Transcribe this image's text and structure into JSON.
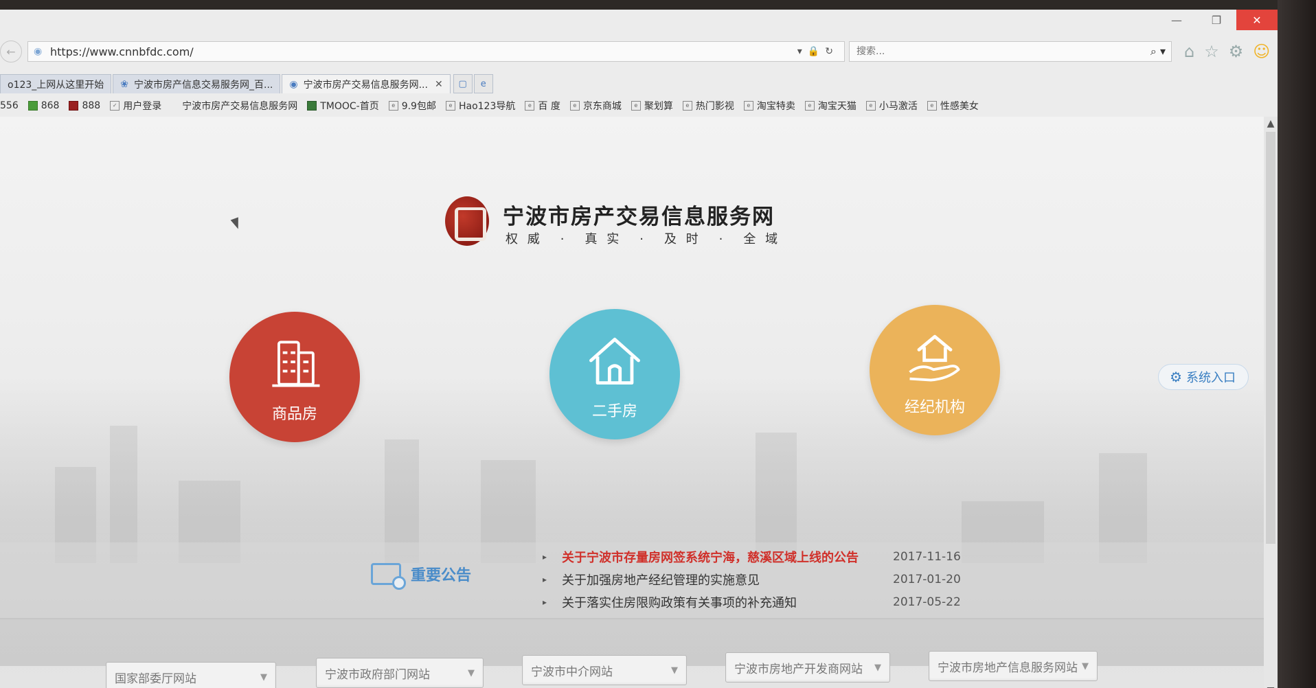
{
  "browser": {
    "url": "https://www.cnnbfdc.com/",
    "search_placeholder": "搜索...",
    "tabs": [
      {
        "label": "o123_上网从这里开始",
        "active": false
      },
      {
        "label": "宁波市房产信息交易服务网_百...",
        "active": false
      },
      {
        "label": "宁波市房产交易信息服务网...",
        "active": true
      }
    ],
    "favorites": [
      {
        "label": "556",
        "icon": "favicon"
      },
      {
        "label": "868",
        "icon": "green-leaf-icon"
      },
      {
        "label": "888",
        "icon": "red-square-icon"
      },
      {
        "label": "用户登录",
        "icon": "shield-icon"
      },
      {
        "label": "宁波市房产交易信息服务网",
        "icon": "none"
      },
      {
        "label": "TMOOC-首页",
        "icon": "tm-icon"
      },
      {
        "label": "9.9包邮",
        "icon": "page-icon"
      },
      {
        "label": "Hao123导航",
        "icon": "page-icon"
      },
      {
        "label": "百 度",
        "icon": "page-icon"
      },
      {
        "label": "京东商城",
        "icon": "page-icon"
      },
      {
        "label": "聚划算",
        "icon": "page-icon"
      },
      {
        "label": "热门影视",
        "icon": "page-icon"
      },
      {
        "label": "淘宝特卖",
        "icon": "page-icon"
      },
      {
        "label": "淘宝天猫",
        "icon": "page-icon"
      },
      {
        "label": "小马激活",
        "icon": "page-icon"
      },
      {
        "label": "性感美女",
        "icon": "page-icon"
      }
    ]
  },
  "site": {
    "title": "宁波市房产交易信息服务网",
    "slogan": [
      "权 威",
      "·",
      "真 实",
      "·",
      "及 时",
      "·",
      "全 域"
    ],
    "categories": [
      {
        "label": "商品房",
        "icon": "building-icon",
        "color": "#c84335"
      },
      {
        "label": "二手房",
        "icon": "house-icon",
        "color": "#5ec0d3"
      },
      {
        "label": "经纪机构",
        "icon": "hand-house-icon",
        "color": "#ebb35a"
      }
    ],
    "system_entry": "系统入口",
    "notice_title": "重要公告",
    "notices": [
      {
        "text": "关于宁波市存量房网签系统宁海，慈溪区域上线的公告",
        "date": "2017-11-16",
        "highlight": true
      },
      {
        "text": "关于加强房地产经纪管理的实施意见",
        "date": "2017-01-20",
        "highlight": false
      },
      {
        "text": "关于落实住房限购政策有关事项的补充通知",
        "date": "2017-05-22",
        "highlight": false
      }
    ],
    "link_selects": [
      "国家部委厅网站",
      "宁波市政府部门网站",
      "宁波市中介网站",
      "宁波市房地产开发商网站",
      "宁波市房地产信息服务网站"
    ]
  }
}
